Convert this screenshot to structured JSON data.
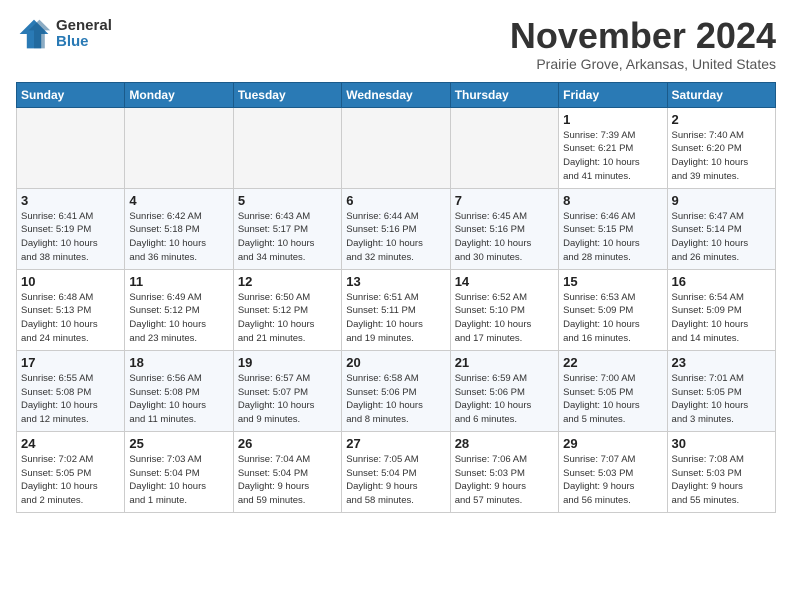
{
  "header": {
    "logo_general": "General",
    "logo_blue": "Blue",
    "month_title": "November 2024",
    "location": "Prairie Grove, Arkansas, United States"
  },
  "days_of_week": [
    "Sunday",
    "Monday",
    "Tuesday",
    "Wednesday",
    "Thursday",
    "Friday",
    "Saturday"
  ],
  "weeks": [
    [
      {
        "num": "",
        "info": "",
        "empty": true
      },
      {
        "num": "",
        "info": "",
        "empty": true
      },
      {
        "num": "",
        "info": "",
        "empty": true
      },
      {
        "num": "",
        "info": "",
        "empty": true
      },
      {
        "num": "",
        "info": "",
        "empty": true
      },
      {
        "num": "1",
        "info": "Sunrise: 7:39 AM\nSunset: 6:21 PM\nDaylight: 10 hours\nand 41 minutes.",
        "empty": false
      },
      {
        "num": "2",
        "info": "Sunrise: 7:40 AM\nSunset: 6:20 PM\nDaylight: 10 hours\nand 39 minutes.",
        "empty": false
      }
    ],
    [
      {
        "num": "3",
        "info": "Sunrise: 6:41 AM\nSunset: 5:19 PM\nDaylight: 10 hours\nand 38 minutes.",
        "empty": false
      },
      {
        "num": "4",
        "info": "Sunrise: 6:42 AM\nSunset: 5:18 PM\nDaylight: 10 hours\nand 36 minutes.",
        "empty": false
      },
      {
        "num": "5",
        "info": "Sunrise: 6:43 AM\nSunset: 5:17 PM\nDaylight: 10 hours\nand 34 minutes.",
        "empty": false
      },
      {
        "num": "6",
        "info": "Sunrise: 6:44 AM\nSunset: 5:16 PM\nDaylight: 10 hours\nand 32 minutes.",
        "empty": false
      },
      {
        "num": "7",
        "info": "Sunrise: 6:45 AM\nSunset: 5:16 PM\nDaylight: 10 hours\nand 30 minutes.",
        "empty": false
      },
      {
        "num": "8",
        "info": "Sunrise: 6:46 AM\nSunset: 5:15 PM\nDaylight: 10 hours\nand 28 minutes.",
        "empty": false
      },
      {
        "num": "9",
        "info": "Sunrise: 6:47 AM\nSunset: 5:14 PM\nDaylight: 10 hours\nand 26 minutes.",
        "empty": false
      }
    ],
    [
      {
        "num": "10",
        "info": "Sunrise: 6:48 AM\nSunset: 5:13 PM\nDaylight: 10 hours\nand 24 minutes.",
        "empty": false
      },
      {
        "num": "11",
        "info": "Sunrise: 6:49 AM\nSunset: 5:12 PM\nDaylight: 10 hours\nand 23 minutes.",
        "empty": false
      },
      {
        "num": "12",
        "info": "Sunrise: 6:50 AM\nSunset: 5:12 PM\nDaylight: 10 hours\nand 21 minutes.",
        "empty": false
      },
      {
        "num": "13",
        "info": "Sunrise: 6:51 AM\nSunset: 5:11 PM\nDaylight: 10 hours\nand 19 minutes.",
        "empty": false
      },
      {
        "num": "14",
        "info": "Sunrise: 6:52 AM\nSunset: 5:10 PM\nDaylight: 10 hours\nand 17 minutes.",
        "empty": false
      },
      {
        "num": "15",
        "info": "Sunrise: 6:53 AM\nSunset: 5:09 PM\nDaylight: 10 hours\nand 16 minutes.",
        "empty": false
      },
      {
        "num": "16",
        "info": "Sunrise: 6:54 AM\nSunset: 5:09 PM\nDaylight: 10 hours\nand 14 minutes.",
        "empty": false
      }
    ],
    [
      {
        "num": "17",
        "info": "Sunrise: 6:55 AM\nSunset: 5:08 PM\nDaylight: 10 hours\nand 12 minutes.",
        "empty": false
      },
      {
        "num": "18",
        "info": "Sunrise: 6:56 AM\nSunset: 5:08 PM\nDaylight: 10 hours\nand 11 minutes.",
        "empty": false
      },
      {
        "num": "19",
        "info": "Sunrise: 6:57 AM\nSunset: 5:07 PM\nDaylight: 10 hours\nand 9 minutes.",
        "empty": false
      },
      {
        "num": "20",
        "info": "Sunrise: 6:58 AM\nSunset: 5:06 PM\nDaylight: 10 hours\nand 8 minutes.",
        "empty": false
      },
      {
        "num": "21",
        "info": "Sunrise: 6:59 AM\nSunset: 5:06 PM\nDaylight: 10 hours\nand 6 minutes.",
        "empty": false
      },
      {
        "num": "22",
        "info": "Sunrise: 7:00 AM\nSunset: 5:05 PM\nDaylight: 10 hours\nand 5 minutes.",
        "empty": false
      },
      {
        "num": "23",
        "info": "Sunrise: 7:01 AM\nSunset: 5:05 PM\nDaylight: 10 hours\nand 3 minutes.",
        "empty": false
      }
    ],
    [
      {
        "num": "24",
        "info": "Sunrise: 7:02 AM\nSunset: 5:05 PM\nDaylight: 10 hours\nand 2 minutes.",
        "empty": false
      },
      {
        "num": "25",
        "info": "Sunrise: 7:03 AM\nSunset: 5:04 PM\nDaylight: 10 hours\nand 1 minute.",
        "empty": false
      },
      {
        "num": "26",
        "info": "Sunrise: 7:04 AM\nSunset: 5:04 PM\nDaylight: 9 hours\nand 59 minutes.",
        "empty": false
      },
      {
        "num": "27",
        "info": "Sunrise: 7:05 AM\nSunset: 5:04 PM\nDaylight: 9 hours\nand 58 minutes.",
        "empty": false
      },
      {
        "num": "28",
        "info": "Sunrise: 7:06 AM\nSunset: 5:03 PM\nDaylight: 9 hours\nand 57 minutes.",
        "empty": false
      },
      {
        "num": "29",
        "info": "Sunrise: 7:07 AM\nSunset: 5:03 PM\nDaylight: 9 hours\nand 56 minutes.",
        "empty": false
      },
      {
        "num": "30",
        "info": "Sunrise: 7:08 AM\nSunset: 5:03 PM\nDaylight: 9 hours\nand 55 minutes.",
        "empty": false
      }
    ]
  ]
}
